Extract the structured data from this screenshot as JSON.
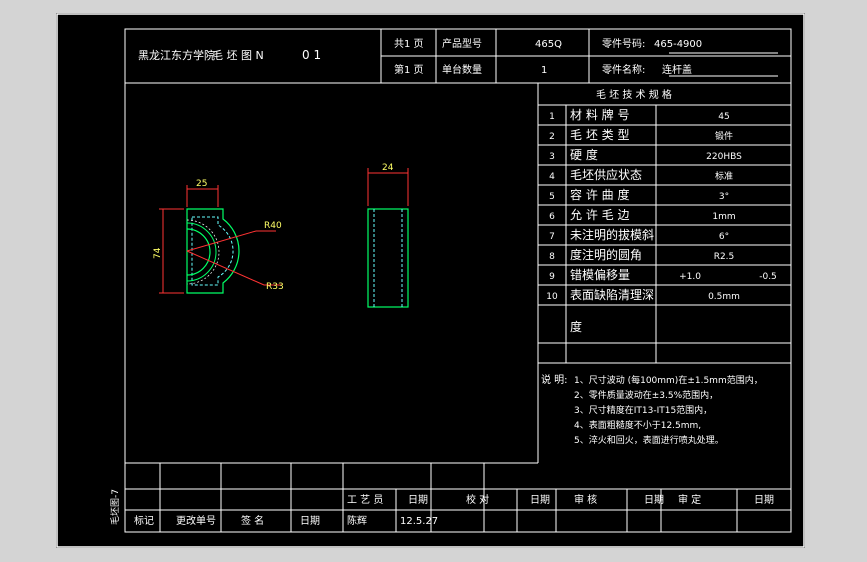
{
  "title_block": {
    "school": "黑龙江东方学院",
    "drawing_title": "毛 坯 图 N",
    "sheet_no": "0 1",
    "total_label": "共1 页",
    "page_label": "第1 页",
    "product_model_label": "产品型号",
    "product_model": "465Q",
    "qty_label": "单台数量",
    "qty": "1",
    "part_no_label": "零件号码:",
    "part_no": "465-4900",
    "part_name_label": "零件名称:",
    "part_name": "连杆盖"
  },
  "tech_table": {
    "header": "毛 坯 技 术 规 格",
    "rows": [
      {
        "no": "1",
        "item": "材 料 牌 号",
        "value": "45"
      },
      {
        "no": "2",
        "item": "毛 坯 类 型",
        "value": "锻件"
      },
      {
        "no": "3",
        "item": "硬     度",
        "value": "220HBS"
      },
      {
        "no": "4",
        "item": "毛坯供应状态",
        "value": "标准"
      },
      {
        "no": "5",
        "item": "容 许 曲 度",
        "value": "3°"
      },
      {
        "no": "6",
        "item": "允 许 毛 边",
        "value": "1mm"
      },
      {
        "no": "7",
        "item": "未注明的拔模斜",
        "value": "6°"
      },
      {
        "no": "8",
        "item": "度注明的圆角",
        "value": "R2.5"
      },
      {
        "no": "9",
        "item": "错模偏移量",
        "value": "+1.0",
        "value2": "-0.5"
      },
      {
        "no": "10",
        "item": "表面缺陷清理深",
        "value": "0.5mm"
      },
      {
        "no": "",
        "item": "度",
        "value": ""
      }
    ]
  },
  "notes": {
    "label": "说 明:",
    "lines": [
      "1、尺寸波动 (每100mm)在±1.5mm范围内，",
      "2、零件质量波动在±3.5%范围内，",
      "3、尺寸精度在IT13-IT15范围内，",
      "4、表面粗糙度不小于12.5mm,",
      "5、淬火和回火，表面进行喷丸处理。"
    ]
  },
  "dimensions": {
    "width_left": "25",
    "height_left": "74",
    "radius_outer": "R40",
    "radius_inner": "R33",
    "width_right": "24"
  },
  "bottom_block": {
    "process": "工 艺 员",
    "date1": "日期",
    "check": "校    对",
    "date2": "日期",
    "review": "审    核",
    "date3": "日期",
    "approve": "审    定",
    "date4": "日期",
    "mark": "标记",
    "change_no": "更改单号",
    "signature": "签    名",
    "date5": "日期",
    "drafter": "陈辉",
    "draft_date": "12.5.27",
    "side_text": "毛坯图-7"
  },
  "colors": {
    "frame": "#ffffff",
    "dimension": "#ff3333",
    "part": "#00ff66",
    "hatch": "#ffffff"
  }
}
